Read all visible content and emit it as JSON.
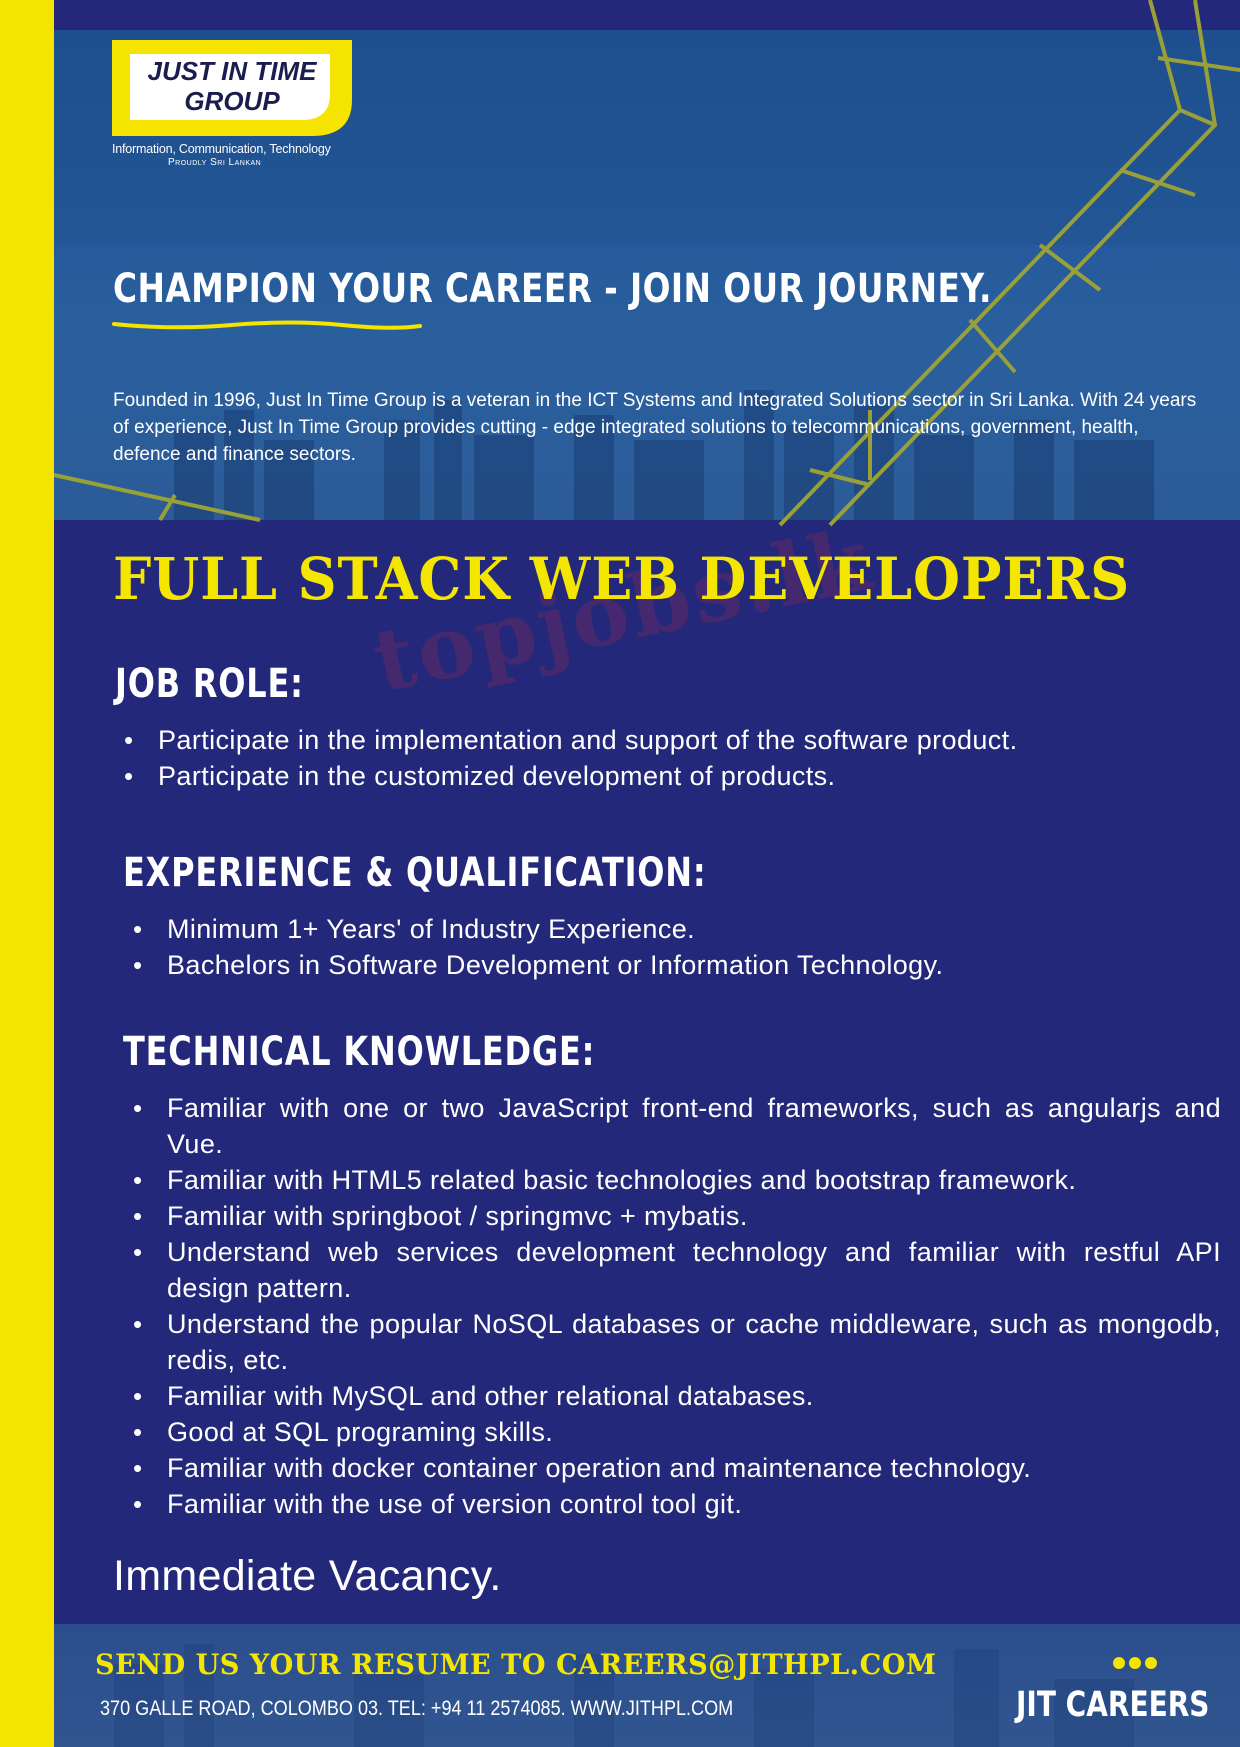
{
  "colors": {
    "accent_yellow": "#f5e600",
    "navy": "#23287a",
    "hero_blue": "#225694"
  },
  "logo": {
    "name_line1": "JUST IN TIME",
    "name_line2": "GROUP",
    "subtitle": "Information, Communication, Technology",
    "tagline": "Proudly Sri Lankan"
  },
  "hero": {
    "headline": "CHAMPION YOUR CAREER - JOIN OUR JOURNEY.",
    "intro": "Founded in 1996, Just In Time Group is a veteran in the ICT Systems and Integrated Solutions sector in Sri Lanka. With 24 years of experience, Just In Time Group provides cutting - edge integrated solutions to telecommunications, government, health, defence and finance sectors."
  },
  "job_title": "FULL STACK WEB DEVELOPERS",
  "watermark": "topjobs.lk",
  "job_role": {
    "heading": "JOB ROLE:",
    "items": [
      "Participate in the implementation and support of the software product.",
      "Participate in the customized development of products."
    ]
  },
  "experience": {
    "heading": "EXPERIENCE & QUALIFICATION:",
    "items": [
      "Minimum 1+ Years' of Industry Experience.",
      "Bachelors in Software Development or Information Technology."
    ]
  },
  "technical": {
    "heading": "TECHNICAL KNOWLEDGE:",
    "items": [
      "Familiar with one or two JavaScript front-end frameworks, such as angularjs and Vue.",
      "Familiar with HTML5 related basic technologies and bootstrap framework.",
      "Familiar with springboot / springmvc + mybatis.",
      "Understand web services development technology and familiar with restful API design pattern.",
      "Understand the popular NoSQL databases or cache middleware, such as mongodb, redis, etc.",
      "Familiar with MySQL and other relational databases.",
      "Good at SQL programing skills.",
      "Familiar with docker container operation and maintenance technology.",
      "Familiar with the use of version control tool git."
    ]
  },
  "immediate": "Immediate Vacancy.",
  "footer": {
    "send_resume": "SEND US YOUR RESUME TO CAREERS@JITHPL.COM",
    "address": "370 GALLE ROAD, COLOMBO 03.   TEL: +94 11 2574085.   WWW.JITHPL.COM",
    "brand": "JIT CAREERS"
  }
}
